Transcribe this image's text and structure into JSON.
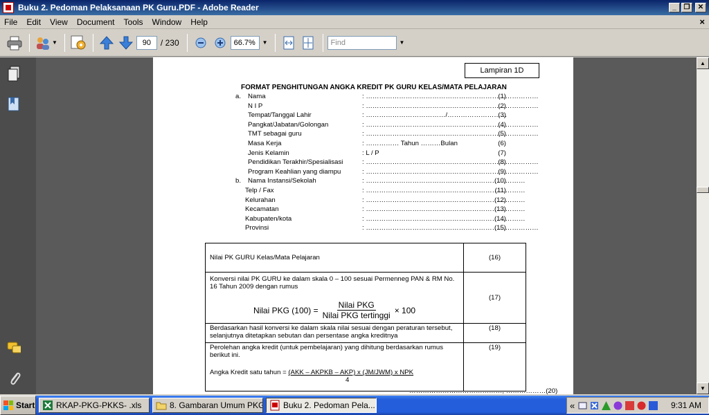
{
  "window": {
    "title": "Buku 2. Pedoman Pelaksanaan PK Guru.PDF - Adobe Reader",
    "min_glyph": "_",
    "max_glyph": "❐",
    "close_glyph": "✕"
  },
  "menu": {
    "items": [
      "File",
      "Edit",
      "View",
      "Document",
      "Tools",
      "Window",
      "Help"
    ],
    "close_doc": "×"
  },
  "toolbar": {
    "page_current": "90",
    "page_sep": "/ 230",
    "zoom": "66.7%",
    "find_placeholder": "Find"
  },
  "document": {
    "lampiran": "Lampiran 1D",
    "heading": "FORMAT PENGHITUNGAN ANGKA KREDIT PK GURU KELAS/MATA PELAJARAN",
    "rows": [
      {
        "mk": "a.",
        "lbl": "Nama",
        "col": ":  ……………………………………………………………………",
        "num": "(1)"
      },
      {
        "mk": "",
        "lbl": "N I P",
        "col": ":  ……………………………………………………………………",
        "num": "(2)"
      },
      {
        "mk": "",
        "lbl": "Tempat/Tanggal Lahir",
        "col": ":  ………………………………/………………………",
        "num": "(3)"
      },
      {
        "mk": "",
        "lbl": "Pangkat/Jabatan/Golongan",
        "col": ":  ……………………………………………………………………",
        "num": "(4)"
      },
      {
        "mk": "",
        "lbl": "TMT sebagai guru",
        "col": ":  ……………………………………………………………………",
        "num": "(5)"
      },
      {
        "mk": "",
        "lbl": "Masa Kerja",
        "col": ":  …………… Tahun  ………Bulan",
        "num": "(6)"
      },
      {
        "mk": "",
        "lbl": "Jenis Kelamin",
        "col": ": L / P",
        "num": "(7)"
      },
      {
        "mk": "",
        "lbl": "Pendidikan Terakhir/Spesialisasi",
        "col": ":  ……………………………………………………………………",
        "num": "(8)"
      },
      {
        "mk": "",
        "lbl": "Program Keahlian yang diampu",
        "col": ":  ……………………………………………………………………",
        "num": "(9)"
      },
      {
        "mk": "b.",
        "lbl": "Nama Instansi/Sekolah",
        "col": ":  ………………………………………………………………",
        "num": "(10)"
      },
      {
        "mk": "",
        "lbl": "Telp / Fax",
        "col": ":  ………………………………………………………………",
        "num": "(11)"
      },
      {
        "mk": "",
        "lbl": "Kelurahan",
        "col": ":  ………………………………………………………………",
        "num": "(12)"
      },
      {
        "mk": "",
        "lbl": "Kecamatan",
        "col": ":  ………………………………………………………………",
        "num": "(13)"
      },
      {
        "mk": "",
        "lbl": "Kabupaten/kota",
        "col": ":  ………………………………………………………………",
        "num": "(14)"
      },
      {
        "mk": "",
        "lbl": "Provinsi",
        "col": ":  ……………………………………………………………………",
        "num": "(15)"
      }
    ],
    "table": {
      "r1_text": "Nilai PK GURU Kelas/Mata Pelajaran",
      "r1_num": "(16)",
      "r2_text": "Konversi nilai PK GURU ke dalam skala 0 – 100  sesuai Permenneg PAN & RM No. 16 Tahun 2009 dengan rumus",
      "r2_formula_left": "Nilai PKG (100) =",
      "r2_formula_top": "Nilai PKG",
      "r2_formula_bottom": "Nilai PKG tertinggi",
      "r2_formula_right": "× 100",
      "r2_num": "(17)",
      "r3_text": "Berdasarkan hasil konversi ke dalam skala nilai sesuai dengan peraturan tersebut, selanjutnya ditetapkan sebutan dan persentase angka kreditnya",
      "r3_num": "(18)",
      "r4_text": "Perolehan angka kredit (untuk pembelajaran) yang dihitung berdasarkan rumus berikut ini.",
      "r4_formula_prefix": "Angka Kredit satu tahun = ",
      "r4_formula_top": "(AKK – AKPKB – AKP) x (JM/JWM) x NPK",
      "r4_formula_bottom": "4",
      "r4_num": "(19)"
    },
    "last_line": "……………………………………, ………………(20)"
  },
  "taskbar": {
    "start": "Start",
    "tasks": [
      "RKAP-PKG-PKKS- .xls",
      "8. Gambaran Umum PKG",
      "Buku 2. Pedoman Pela..."
    ],
    "tray_chevron": "«",
    "clock": "9:31 AM"
  }
}
